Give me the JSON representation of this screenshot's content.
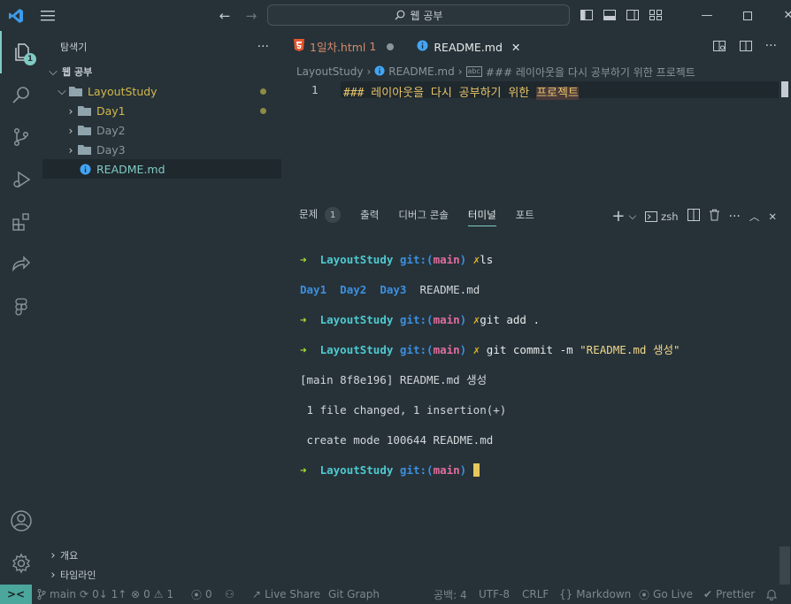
{
  "titlebar": {
    "search_text": "웹 공부",
    "back_icon": "arrow-left-icon",
    "forward_icon": "arrow-right-icon"
  },
  "activitybar": {
    "explorer_badge": "1"
  },
  "sidebar": {
    "title": "탐색기",
    "more": "···",
    "workspace": "웹 공부",
    "tree": [
      {
        "label": "LayoutStudy",
        "kind": "folder-open"
      },
      {
        "label": "Day1",
        "kind": "folder"
      },
      {
        "label": "Day2",
        "kind": "folder"
      },
      {
        "label": "Day3",
        "kind": "folder"
      },
      {
        "label": "README.md",
        "kind": "file-info"
      }
    ],
    "outline": "개요",
    "timeline": "타임라인"
  },
  "tabs": [
    {
      "label": "1일차.html",
      "badge": "1"
    },
    {
      "label": "README.md"
    }
  ],
  "breadcrumb": {
    "folder": "LayoutStudy",
    "file": "README.md",
    "symbol": "### 레이아웃을 다시 공부하기 위한 프로젝트"
  },
  "editor": {
    "line_number": "1",
    "code_prefix": "### 레이아웃을 다시 공부하기 위한 ",
    "code_highlight": "프로젝트"
  },
  "panel": {
    "tabs": [
      "문제",
      "출력",
      "디버그 콘솔",
      "터미널",
      "포트"
    ],
    "problems_count": "1",
    "shell": "zsh",
    "add": "+",
    "more": "···"
  },
  "terminal": {
    "arrow": "➜",
    "dir": "LayoutStudy",
    "git_prefix": "git:(",
    "branch": "main",
    "git_suffix": ")",
    "x": "✗",
    "cmd1": "ls",
    "ls_output": [
      "Day1",
      "Day2",
      "Day3"
    ],
    "ls_file": "README.md",
    "cmd2": "git add .",
    "cmd3": "git commit -m ",
    "cmd3_str": "\"README.md 생성\"",
    "out1": "[main 8f8e196] README.md 생성",
    "out2": " 1 file changed, 1 insertion(+)",
    "out3": " create mode 100644 README.md"
  },
  "statusbar": {
    "remote": "><",
    "branch": "main",
    "sync": "0↓ 1↑",
    "errors": "0",
    "warnings": "1",
    "ports": "0",
    "liveshare": "Live Share",
    "gitgraph": "Git Graph",
    "spaces": "공백: 4",
    "encoding": "UTF-8",
    "eol": "CRLF",
    "language": "Markdown",
    "golive": "Go Live",
    "prettier": "Prettier"
  }
}
